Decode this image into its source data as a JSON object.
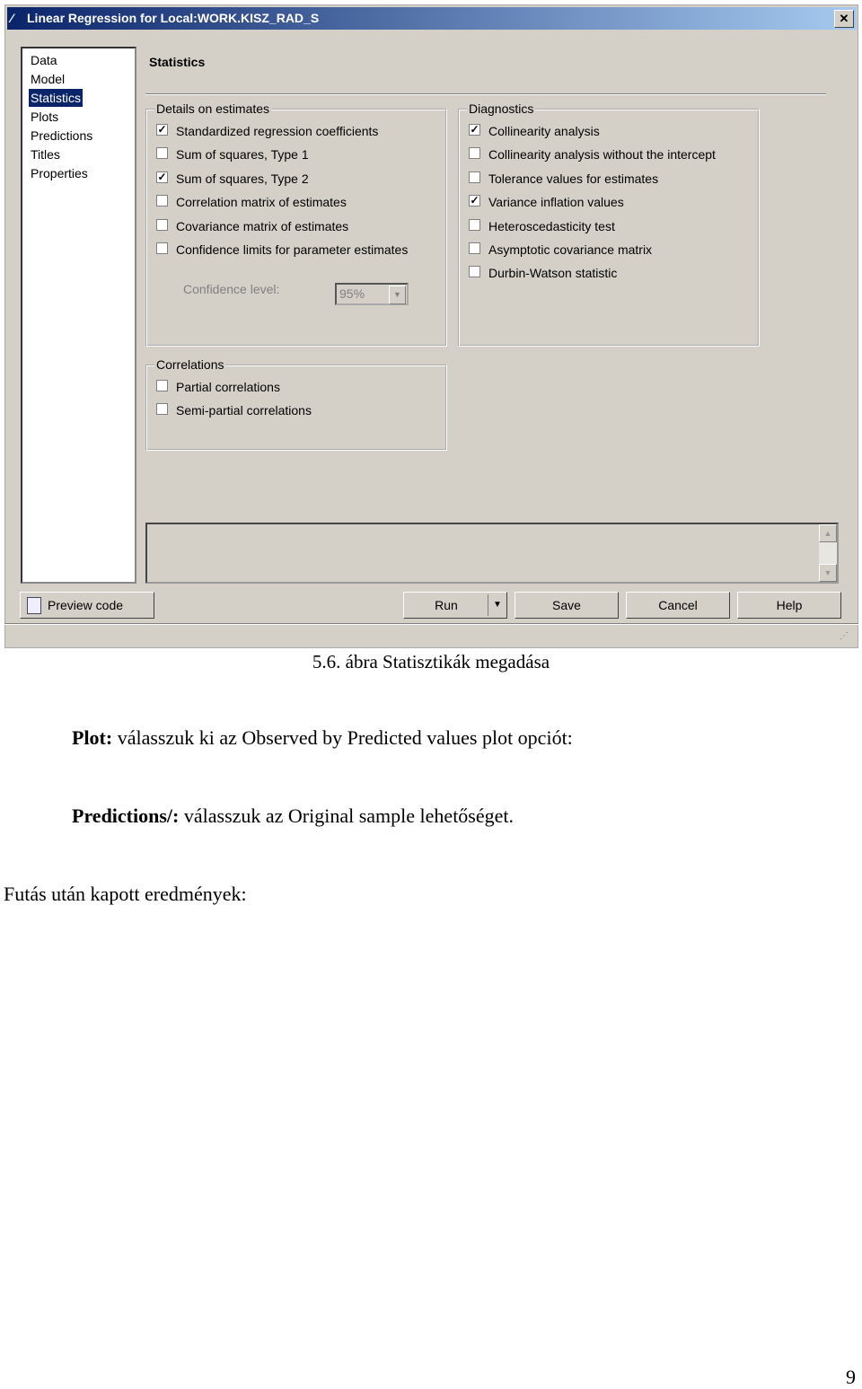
{
  "dialog": {
    "title": "Linear Regression for Local:WORK.KISZ_RAD_S",
    "close": "✕",
    "nav": [
      "Data",
      "Model",
      "Statistics",
      "Plots",
      "Predictions",
      "Titles",
      "Properties"
    ],
    "selected_nav": "Statistics",
    "section_title": "Statistics",
    "details": {
      "label": "Details on estimates",
      "items": [
        {
          "label": "Standardized regression coefficients",
          "checked": true
        },
        {
          "label": "Sum of squares, Type 1",
          "checked": false
        },
        {
          "label": "Sum of squares, Type 2",
          "checked": true
        },
        {
          "label": "Correlation matrix of estimates",
          "checked": false
        },
        {
          "label": "Covariance matrix of estimates",
          "checked": false
        },
        {
          "label": "Confidence limits for parameter estimates",
          "checked": false
        }
      ],
      "confidence_label": "Confidence level:",
      "confidence_value": "95%"
    },
    "diagnostics": {
      "label": "Diagnostics",
      "items": [
        {
          "label": "Collinearity analysis",
          "checked": true
        },
        {
          "label": "Collinearity analysis without the intercept",
          "checked": false
        },
        {
          "label": "Tolerance values for estimates",
          "checked": false
        },
        {
          "label": "Variance inflation values",
          "checked": true
        },
        {
          "label": "Heteroscedasticity test",
          "checked": false
        },
        {
          "label": "Asymptotic covariance matrix",
          "checked": false
        },
        {
          "label": "Durbin-Watson statistic",
          "checked": false
        }
      ]
    },
    "correlations": {
      "label": "Correlations",
      "items": [
        {
          "label": "Partial correlations",
          "checked": false
        },
        {
          "label": "Semi-partial correlations",
          "checked": false
        }
      ]
    },
    "buttons": {
      "preview": "Preview code",
      "run": "Run",
      "save": "Save",
      "cancel": "Cancel",
      "help": "Help"
    }
  },
  "doc": {
    "caption": "5.6. ábra Statisztikák megadása",
    "p1_bold": "Plot:",
    "p1": " válasszuk ki az Observed by Predicted values plot opciót:",
    "p2_bold": "Predictions/:",
    "p2": " válasszuk az Original sample lehetőséget.",
    "p3": "Futás után kapott eredmények:",
    "page_number": "9"
  }
}
